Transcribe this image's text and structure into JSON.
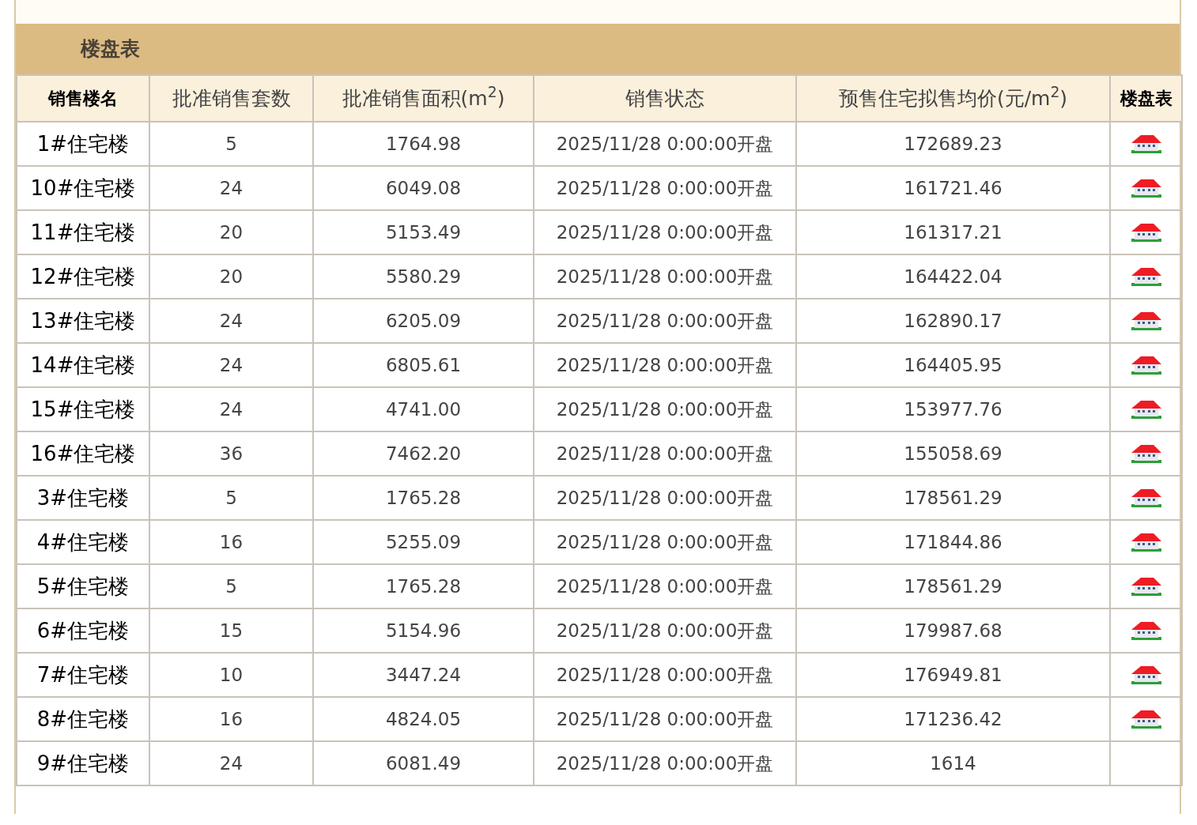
{
  "panel": {
    "title": "楼盘表"
  },
  "table": {
    "columns": [
      {
        "label": "销售楼名",
        "bold": true
      },
      {
        "label": "批准销售套数",
        "bold": false
      },
      {
        "label": "批准销售面积(m$^{2}$)",
        "bold": false
      },
      {
        "label": "销售状态",
        "bold": false
      },
      {
        "label": "预售住宅拟售均价(元/m$^{2}$)",
        "bold": false
      },
      {
        "label": "楼盘表",
        "bold": true
      }
    ],
    "rows": [
      {
        "name": "1#住宅楼",
        "units": "5",
        "area": "1764.98",
        "status": "2025/11/28 0:00:00开盘",
        "price": "172689.23",
        "link": true
      },
      {
        "name": "10#住宅楼",
        "units": "24",
        "area": "6049.08",
        "status": "2025/11/28 0:00:00开盘",
        "price": "161721.46",
        "link": true
      },
      {
        "name": "11#住宅楼",
        "units": "20",
        "area": "5153.49",
        "status": "2025/11/28 0:00:00开盘",
        "price": "161317.21",
        "link": true
      },
      {
        "name": "12#住宅楼",
        "units": "20",
        "area": "5580.29",
        "status": "2025/11/28 0:00:00开盘",
        "price": "164422.04",
        "link": true
      },
      {
        "name": "13#住宅楼",
        "units": "24",
        "area": "6205.09",
        "status": "2025/11/28 0:00:00开盘",
        "price": "162890.17",
        "link": true
      },
      {
        "name": "14#住宅楼",
        "units": "24",
        "area": "6805.61",
        "status": "2025/11/28 0:00:00开盘",
        "price": "164405.95",
        "link": true
      },
      {
        "name": "15#住宅楼",
        "units": "24",
        "area": "4741.00",
        "status": "2025/11/28 0:00:00开盘",
        "price": "153977.76",
        "link": true
      },
      {
        "name": "16#住宅楼",
        "units": "36",
        "area": "7462.20",
        "status": "2025/11/28 0:00:00开盘",
        "price": "155058.69",
        "link": true
      },
      {
        "name": "3#住宅楼",
        "units": "5",
        "area": "1765.28",
        "status": "2025/11/28 0:00:00开盘",
        "price": "178561.29",
        "link": true
      },
      {
        "name": "4#住宅楼",
        "units": "16",
        "area": "5255.09",
        "status": "2025/11/28 0:00:00开盘",
        "price": "171844.86",
        "link": true
      },
      {
        "name": "5#住宅楼",
        "units": "5",
        "area": "1765.28",
        "status": "2025/11/28 0:00:00开盘",
        "price": "178561.29",
        "link": true
      },
      {
        "name": "6#住宅楼",
        "units": "15",
        "area": "5154.96",
        "status": "2025/11/28 0:00:00开盘",
        "price": "179987.68",
        "link": true
      },
      {
        "name": "7#住宅楼",
        "units": "10",
        "area": "3447.24",
        "status": "2025/11/28 0:00:00开盘",
        "price": "176949.81",
        "link": true
      },
      {
        "name": "8#住宅楼",
        "units": "16",
        "area": "4824.05",
        "status": "2025/11/28 0:00:00开盘",
        "price": "171236.42",
        "link": true
      },
      {
        "name": "9#住宅楼",
        "units": "24",
        "area": "6081.49",
        "status": "2025/11/28 0:00:00开盘",
        "price": "1614",
        "link": false
      }
    ]
  }
}
